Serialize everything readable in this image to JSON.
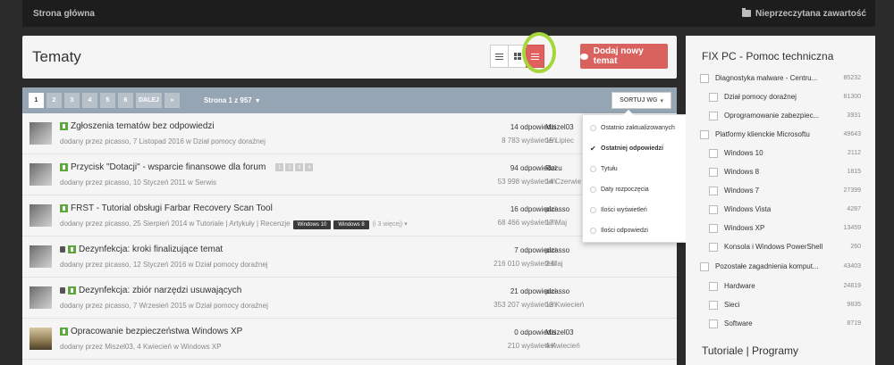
{
  "breadcrumb": {
    "home": "Strona główna"
  },
  "topbar": {
    "unread": "Nieprzeczytana zawartość"
  },
  "header": {
    "title": "Tematy",
    "add_button": "Dodaj nowy temat"
  },
  "pagination": {
    "pages": [
      "1",
      "2",
      "3",
      "4",
      "5",
      "6"
    ],
    "next": "DALEJ",
    "last": "»",
    "info": "Strona 1 z 957",
    "sort_button": "SORTUJ WG"
  },
  "topics": [
    {
      "title": "Zgłoszenia tematów bez odpowiedzi",
      "meta": "dodany przez picasso, 7 Listopad 2016 w Dział pomocy doraźnej",
      "replies": "14 odpowiedzi",
      "views": "8 783 wyświetleń",
      "last_user": "Miszel03",
      "last_date": "15 Lipiec"
    },
    {
      "title": "Przycisk \"Dotacji\" - wsparcie finansowe dla forum",
      "meta": "dodany przez picasso, 10 Styczeń 2011 w Serwis",
      "page_dots": [
        "1",
        "2",
        "3",
        "4"
      ],
      "replies": "94 odpowiedzi",
      "views": "53 998 wyświetleń",
      "last_user": "Rozu",
      "last_date": "14 Czerwie"
    },
    {
      "title": "FRST - Tutorial obsługi Farbar Recovery Scan Tool",
      "meta": "dodany przez picasso, 25 Sierpień 2014 w Tutoriale | Artykuły | Recenzje",
      "tags": [
        "Windows 10",
        "Windows 8"
      ],
      "tags_more": "(i 3 więcej) ▾",
      "replies": "16 odpowiedzi",
      "views": "68 466 wyświetleń",
      "last_user": "picasso",
      "last_date": "17 Maj"
    },
    {
      "title": "Dezynfekcja: kroki finalizujące temat",
      "meta": "dodany przez picasso, 12 Styczeń 2016 w Dział pomocy doraźnej",
      "replies": "7 odpowiedzi",
      "views": "216 010 wyświetleń",
      "last_user": "picasso",
      "last_date": "2 Maj"
    },
    {
      "title": "Dezynfekcja: zbiór narzędzi usuwających",
      "meta": "dodany przez picasso, 7 Wrzesień 2015 w Dział pomocy doraźnej",
      "replies": "21 odpowiedzi",
      "views": "353 207 wyświetleń",
      "last_user": "picasso",
      "last_date": "13 Kwiecień"
    },
    {
      "title": "Opracowanie bezpieczeństwa Windows XP",
      "meta": "dodany przez Miszel03, 4 Kwiecień w Windows XP",
      "replies": "0 odpowiedzi",
      "views": "210 wyświetleń",
      "last_user": "Miszel03",
      "last_date": "4 Kwiecień"
    }
  ],
  "sort_menu": {
    "items": [
      "Ostatnio zaktualizowanych",
      "Ostatniej odpowiedzi",
      "Tytułu",
      "Daty rozpoczęcia",
      "Ilości wyświetleń",
      "Ilości odpowiedzi"
    ],
    "selected": "Ostatniej odpowiedzi"
  },
  "sidebar": {
    "title": "FIX PC - Pomoc techniczna",
    "items": [
      {
        "label": "Diagnostyka malware - Centru...",
        "count": "85232"
      },
      {
        "label": "Dział pomocy doraźnej",
        "count": "81300"
      },
      {
        "label": "Oprogramowanie zabezpiec...",
        "count": "3931"
      },
      {
        "label": "Platformy klienckie Microsoftu",
        "count": "49643"
      },
      {
        "label": "Windows 10",
        "count": "2112"
      },
      {
        "label": "Windows 8",
        "count": "1815"
      },
      {
        "label": "Windows 7",
        "count": "27399"
      },
      {
        "label": "Windows Vista",
        "count": "4287"
      },
      {
        "label": "Windows XP",
        "count": "13459"
      },
      {
        "label": "Konsola i Windows PowerShell",
        "count": "260"
      },
      {
        "label": "Pozostałe zagadnienia komput...",
        "count": "43403"
      },
      {
        "label": "Hardware",
        "count": "24819"
      },
      {
        "label": "Sieci",
        "count": "9835"
      },
      {
        "label": "Software",
        "count": "8719"
      }
    ],
    "title2": "Tutoriale | Programy"
  },
  "colors": {
    "accent": "#d9625e",
    "highlight_ring": "#a5d63a",
    "pin": "#5fa73d",
    "pagebar": "#95a5b3"
  }
}
